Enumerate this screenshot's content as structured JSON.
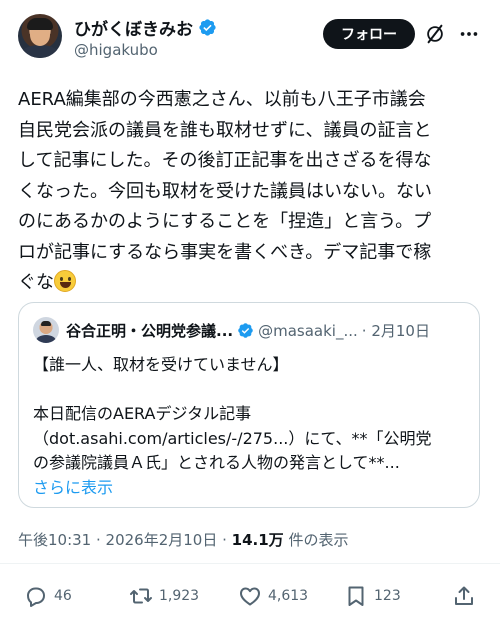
{
  "author": {
    "display_name": "ひがくぼきみお",
    "handle": "@higakubo",
    "follow_label": "フォロー"
  },
  "tweet": {
    "lines": [
      "AERA編集部の今西憲之さん、以前も八王子市議会",
      "自民党会派の議員を誰も取材せずに、議員の証言と",
      "して記事にした。その後訂正記事を出さざるを得な",
      "くなった。今回も取材を受けた議員はいない。ない",
      "のにあるかのようにすることを「捏造」と言う。プ",
      "ロが記事にするなら事実を書くべき。デマ記事で稼",
      "ぐな"
    ],
    "emoji": "grinning-face-emoji"
  },
  "quote": {
    "name": "谷合正明・公明党参議...",
    "handle": "@masaaki_...",
    "date": "· 2月10日",
    "lines": [
      "【誰一人、取材を受けていません】",
      "",
      "本日配信のAERAデジタル記事",
      "（dot.asahi.com/articles/-/275...）にて、**「公明党",
      "の参議院議員Ａ氏」とされる人物の発言として**..."
    ],
    "show_more": "さらに表示"
  },
  "meta": {
    "time_date": "午後10:31 · 2026年2月10日 · ",
    "views_count": "14.1万",
    "views_label": " 件の表示"
  },
  "actions": {
    "replies": "46",
    "reposts": "1,923",
    "likes": "4,613",
    "bookmarks": "123"
  },
  "colors": {
    "accent": "#1d9bf0",
    "verified_gold": "#1d9bf0",
    "text": "#0f1419",
    "secondary": "#536471"
  }
}
